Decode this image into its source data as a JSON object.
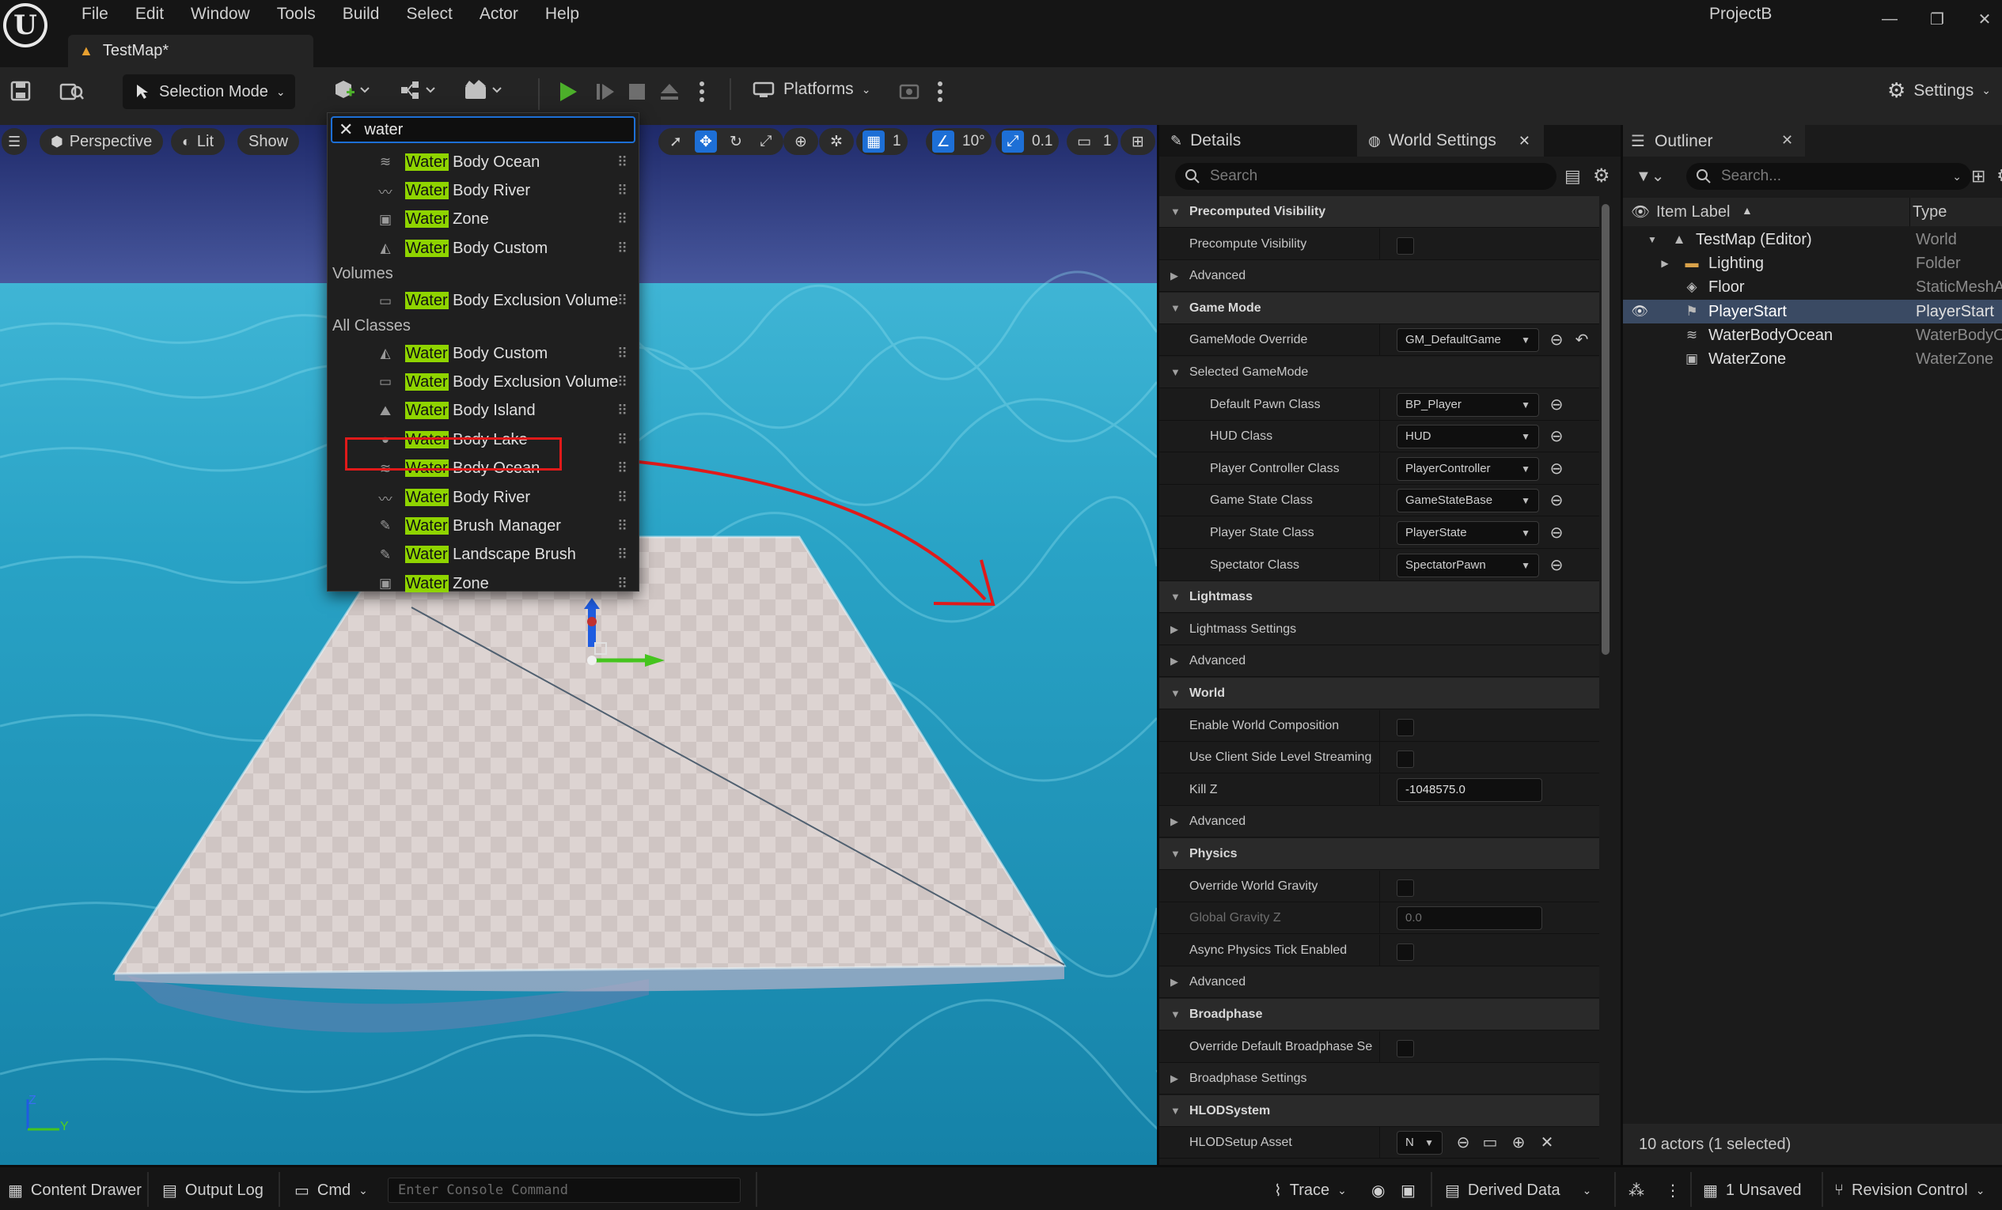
{
  "menubar": {
    "items": [
      "File",
      "Edit",
      "Window",
      "Tools",
      "Build",
      "Select",
      "Actor",
      "Help"
    ],
    "project": "ProjectB",
    "doc_tab": "TestMap*"
  },
  "toolbar": {
    "selection_mode": "Selection Mode",
    "platforms": "Platforms",
    "settings": "Settings"
  },
  "viewport": {
    "perspective": "Perspective",
    "lit": "Lit",
    "show": "Show",
    "grid_size": "1",
    "rot_snap": "10°",
    "scale_snap": "0.1",
    "cam_speed": "1",
    "axis_z": "Z",
    "axis_y": "Y"
  },
  "dropdown": {
    "search": "water",
    "highlight_word": "Water",
    "group_volumes": "Volumes",
    "group_all": "All Classes",
    "rows_top": [
      {
        "rest": " Body Ocean",
        "icon": "≋"
      },
      {
        "rest": " Body River",
        "icon": "〰"
      },
      {
        "rest": " Zone",
        "icon": "▣"
      },
      {
        "rest": " Body Custom",
        "icon": "◭"
      }
    ],
    "rows_volumes": [
      {
        "rest": " Body Exclusion Volume",
        "icon": "▭"
      }
    ],
    "rows_all": [
      {
        "rest": " Body Custom",
        "icon": "◭"
      },
      {
        "rest": " Body Exclusion Volume",
        "icon": "▭"
      },
      {
        "rest": " Body Island",
        "icon": "⛰"
      },
      {
        "rest": " Body Lake",
        "icon": "◒"
      },
      {
        "rest": " Body Ocean",
        "icon": "≋"
      },
      {
        "rest": " Body River",
        "icon": "〰"
      },
      {
        "rest": " Brush Manager",
        "icon": "✎"
      },
      {
        "rest": " Landscape Brush",
        "icon": "✎"
      },
      {
        "rest": " Zone",
        "icon": "▣"
      }
    ]
  },
  "details": {
    "tab_details": "Details",
    "tab_world": "World Settings",
    "search_placeholder": "Search",
    "rows": [
      {
        "label": "Precomputed Visibility",
        "kind": "cat"
      },
      {
        "label": "Precompute Visibility",
        "kind": "norm",
        "widget": "check"
      },
      {
        "label": "Advanced",
        "kind": "sub"
      },
      {
        "label": "Game Mode",
        "kind": "cat"
      },
      {
        "label": "GameMode Override",
        "kind": "norm",
        "widget": "combo",
        "value": "GM_DefaultGame",
        "reset": true,
        "revert": true
      },
      {
        "label": "Selected GameMode",
        "kind": "sub",
        "open": true
      },
      {
        "label": "Default Pawn Class",
        "kind": "norm",
        "indent": 2,
        "widget": "combo",
        "value": "BP_Player",
        "reset": true
      },
      {
        "label": "HUD Class",
        "kind": "norm",
        "indent": 2,
        "widget": "combo",
        "value": "HUD",
        "reset": true
      },
      {
        "label": "Player Controller Class",
        "kind": "norm",
        "indent": 2,
        "widget": "combo",
        "value": "PlayerController",
        "reset": true
      },
      {
        "label": "Game State Class",
        "kind": "norm",
        "indent": 2,
        "widget": "combo",
        "value": "GameStateBase",
        "reset": true
      },
      {
        "label": "Player State Class",
        "kind": "norm",
        "indent": 2,
        "widget": "combo",
        "value": "PlayerState",
        "reset": true
      },
      {
        "label": "Spectator Class",
        "kind": "norm",
        "indent": 2,
        "widget": "combo",
        "value": "SpectatorPawn",
        "reset": true
      },
      {
        "label": "Lightmass",
        "kind": "cat"
      },
      {
        "label": "Lightmass Settings",
        "kind": "sub"
      },
      {
        "label": "Advanced",
        "kind": "sub"
      },
      {
        "label": "World",
        "kind": "cat"
      },
      {
        "label": "Enable World Composition",
        "kind": "norm",
        "widget": "check"
      },
      {
        "label": "Use Client Side Level Streaming...",
        "kind": "norm",
        "widget": "check"
      },
      {
        "label": "Kill Z",
        "kind": "norm",
        "widget": "num",
        "value": "-1048575.0"
      },
      {
        "label": "Advanced",
        "kind": "sub"
      },
      {
        "label": "Physics",
        "kind": "cat"
      },
      {
        "label": "Override World Gravity",
        "kind": "norm",
        "widget": "check"
      },
      {
        "label": "Global Gravity Z",
        "kind": "norm",
        "widget": "num",
        "value": "0.0",
        "dim": true
      },
      {
        "label": "Async Physics Tick Enabled",
        "kind": "norm",
        "widget": "check"
      },
      {
        "label": "Advanced",
        "kind": "sub"
      },
      {
        "label": "Broadphase",
        "kind": "cat"
      },
      {
        "label": "Override Default Broadphase Se...",
        "kind": "norm",
        "widget": "check"
      },
      {
        "label": "Broadphase Settings",
        "kind": "sub"
      },
      {
        "label": "HLODSystem",
        "kind": "cat"
      },
      {
        "label": "HLODSetup Asset",
        "kind": "norm",
        "widget": "asset",
        "value": "N"
      }
    ]
  },
  "outliner": {
    "tab": "Outliner",
    "search_placeholder": "Search...",
    "col_label": "Item Label",
    "col_type": "Type",
    "rows": [
      {
        "name": "TestMap (Editor)",
        "type": "World",
        "indent": 1,
        "icon": "▲",
        "expander": "open"
      },
      {
        "name": "Lighting",
        "type": "Folder",
        "indent": 2,
        "icon": "▬",
        "expander": "closed",
        "folder": true
      },
      {
        "name": "Floor",
        "type": "StaticMeshA",
        "indent": 2,
        "icon": "◈"
      },
      {
        "name": "PlayerStart",
        "type": "PlayerStart",
        "indent": 2,
        "icon": "⚑",
        "selected": true
      },
      {
        "name": "WaterBodyOcean",
        "type": "WaterBodyO",
        "indent": 2,
        "icon": "≋"
      },
      {
        "name": "WaterZone",
        "type": "WaterZone",
        "indent": 2,
        "icon": "▣"
      }
    ],
    "footer": "10 actors (1 selected)"
  },
  "statusbar": {
    "content_drawer": "Content Drawer",
    "output_log": "Output Log",
    "cmd": "Cmd",
    "console_placeholder": "Enter Console Command",
    "trace": "Trace",
    "derived_data": "Derived Data",
    "unsaved": "1 Unsaved",
    "revision_control": "Revision Control"
  },
  "colors": {
    "accent": "#1d6fd6",
    "highlight": "#8fd400",
    "annotation": "#e01a1a",
    "play": "#4caf2a"
  }
}
